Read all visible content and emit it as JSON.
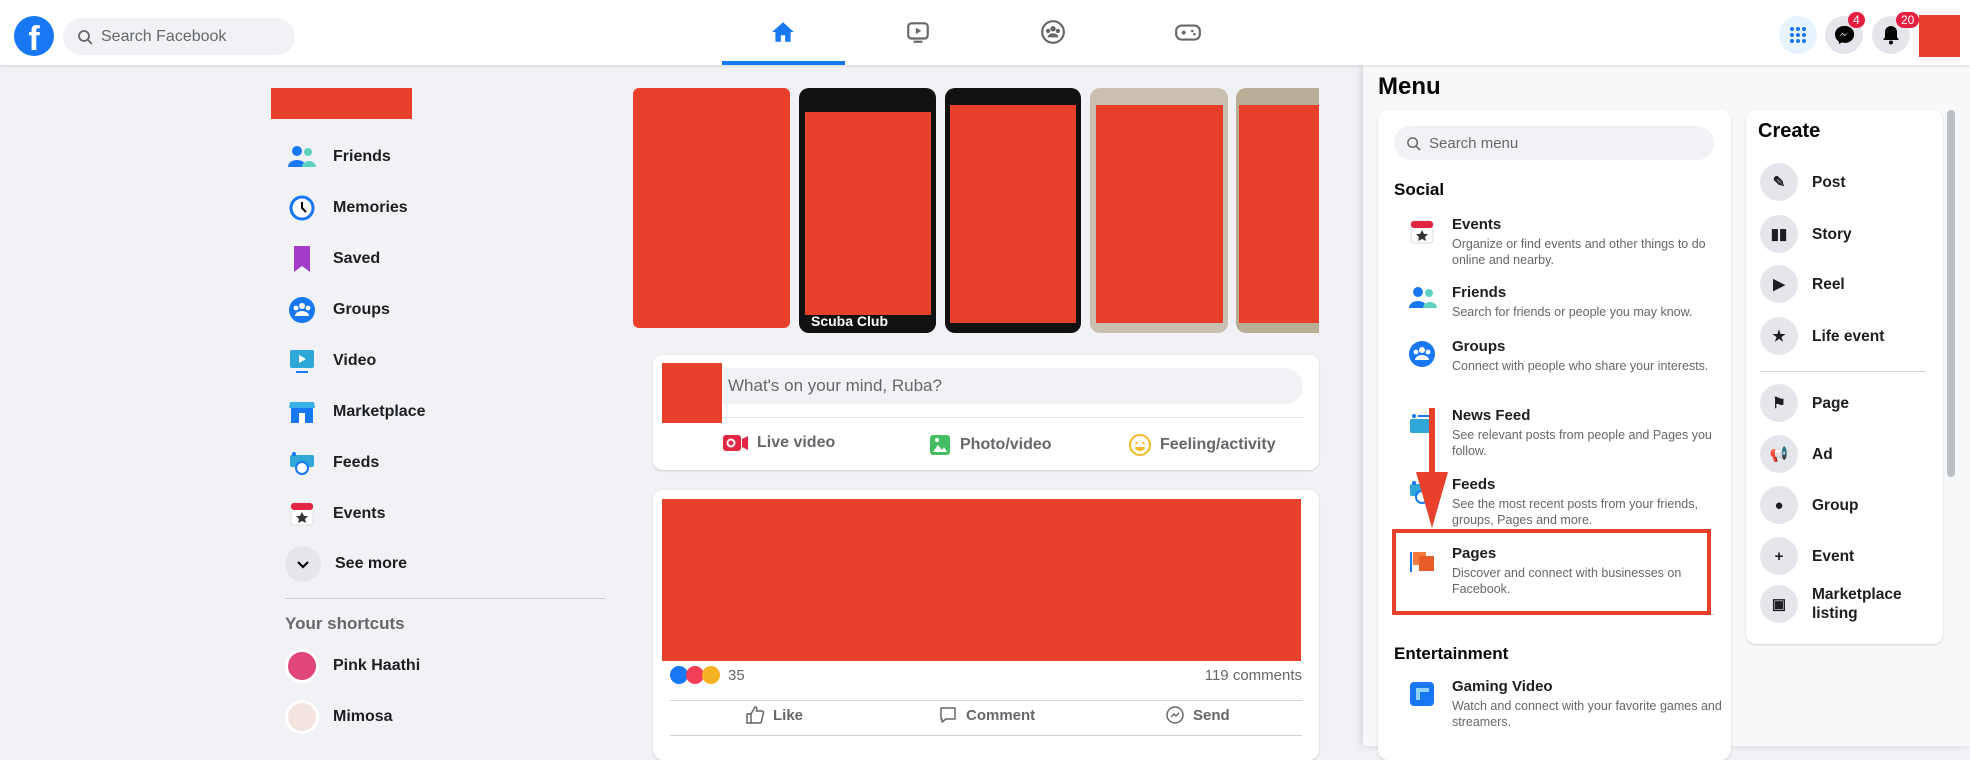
{
  "header": {
    "logo": "f",
    "search_placeholder": "Search Facebook",
    "nav": [
      "home-icon",
      "watch-icon",
      "groups-icon",
      "gaming-icon"
    ],
    "badges": {
      "messenger": "4",
      "notifications": "20"
    }
  },
  "sidebar": {
    "items": [
      {
        "label": "Friends",
        "icon": "friends-icon"
      },
      {
        "label": "Memories",
        "icon": "memories-icon"
      },
      {
        "label": "Saved",
        "icon": "saved-icon"
      },
      {
        "label": "Groups",
        "icon": "groups-icon"
      },
      {
        "label": "Video",
        "icon": "video-icon"
      },
      {
        "label": "Marketplace",
        "icon": "marketplace-icon"
      },
      {
        "label": "Feeds",
        "icon": "feeds-icon"
      },
      {
        "label": "Events",
        "icon": "events-icon"
      }
    ],
    "see_more": "See more",
    "shortcuts_title": "Your shortcuts",
    "shortcuts": [
      {
        "label": "Pink Haathi"
      },
      {
        "label": "Mimosa"
      }
    ]
  },
  "stories": {
    "visible_name": "Scuba Club"
  },
  "composer": {
    "placeholder": "What's on your mind, Ruba?",
    "actions": [
      {
        "label": "Live video",
        "color": "#e42645"
      },
      {
        "label": "Photo/video",
        "color": "#45bd62"
      },
      {
        "label": "Feeling/activity",
        "color": "#f7b928"
      }
    ]
  },
  "post": {
    "reaction_count": "35",
    "comments": "119 comments",
    "actions": [
      "Like",
      "Comment",
      "Send"
    ]
  },
  "menu": {
    "title": "Menu",
    "search_placeholder": "Search menu",
    "social_title": "Social",
    "social": [
      {
        "title": "Events",
        "desc": "Organize or find events and other things to do online and nearby."
      },
      {
        "title": "Friends",
        "desc": "Search for friends or people you may know."
      },
      {
        "title": "Groups",
        "desc": "Connect with people who share your interests."
      },
      {
        "title": "News Feed",
        "desc": "See relevant posts from people and Pages you follow."
      },
      {
        "title": "Feeds",
        "desc": "See the most recent posts from your friends, groups, Pages and more."
      },
      {
        "title": "Pages",
        "desc": "Discover and connect with businesses on Facebook."
      }
    ],
    "entertainment_title": "Entertainment",
    "entertainment": [
      {
        "title": "Gaming Video",
        "desc": "Watch and connect with your favorite games and streamers."
      }
    ],
    "highlight_color": "#e8402a"
  },
  "create": {
    "title": "Create",
    "items": [
      "Post",
      "Story",
      "Reel",
      "Life event",
      "Page",
      "Ad",
      "Group",
      "Event",
      "Marketplace listing"
    ]
  }
}
